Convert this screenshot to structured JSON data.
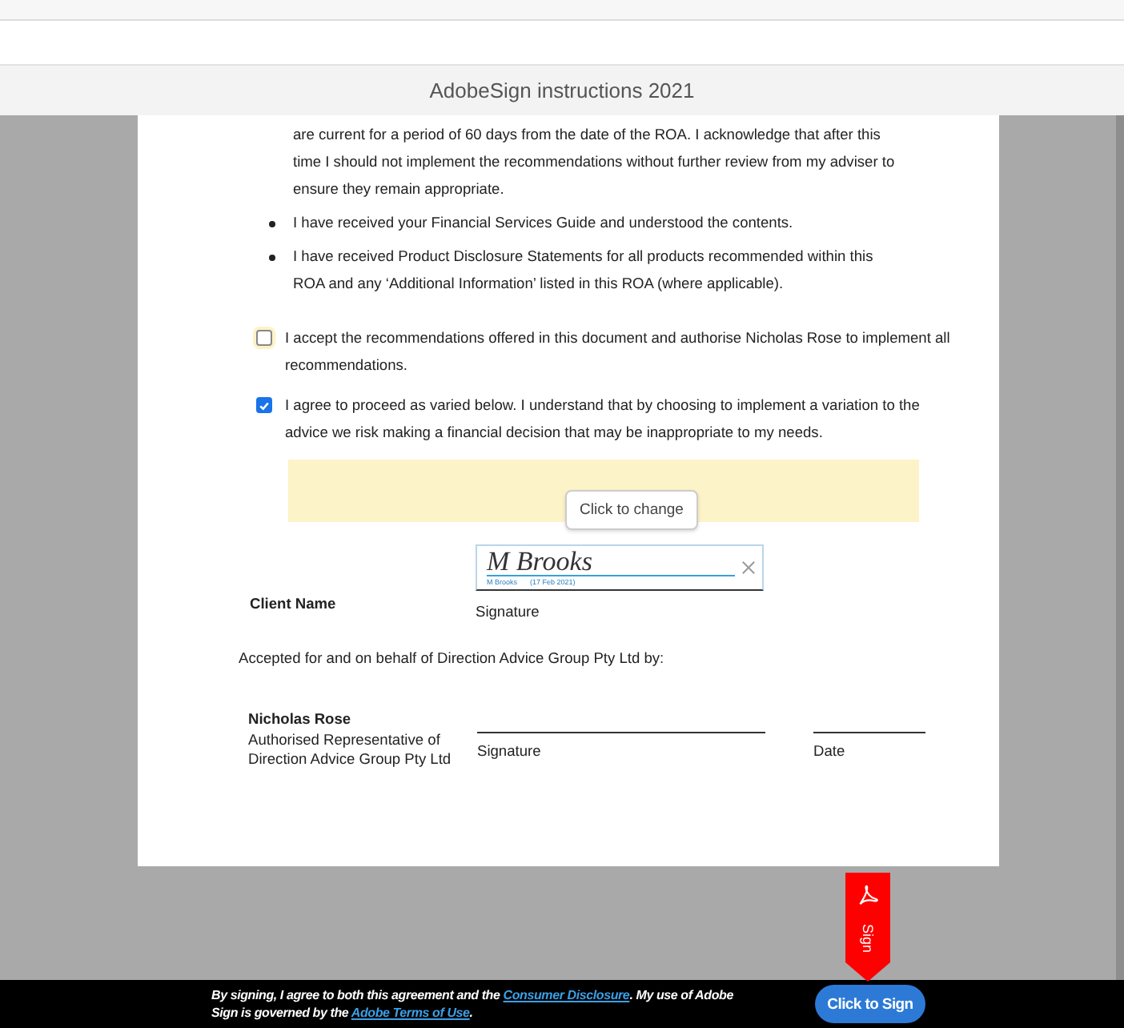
{
  "document_title": "AdobeSign instructions 2021",
  "document": {
    "continued_text": "are current for a period of 60 days from the date of the ROA. I acknowledge that after this time I should not implement the recommendations without further review from my adviser to ensure they remain appropriate.",
    "bullets": [
      "I have received your Financial Services Guide and understood the contents.",
      "I have received Product Disclosure Statements for all products recommended within this ROA and any ‘Additional Information’ listed in this ROA (where applicable)."
    ],
    "checkboxes": [
      {
        "label": "I accept the recommendations offered in this document and authorise Nicholas Rose to implement all recommendations.",
        "checked": false
      },
      {
        "label": "I agree to proceed as varied below. I understand that by choosing to implement a variation to the advice we risk making a financial decision that may be inappropriate to my needs.",
        "checked": true
      }
    ],
    "tooltip": "Click to change",
    "client_label": "Client Name",
    "signature_field": {
      "signature": "M Brooks",
      "signer": "M Brooks",
      "date": "(17 Feb 2021)"
    },
    "signature_caption": "Signature",
    "accepted_text": "Accepted for and on behalf of Direction Advice Group Pty Ltd by:",
    "representative": {
      "name": "Nicholas Rose",
      "title": "Authorised Representative of Direction Advice Group Pty Ltd",
      "signature_caption": "Signature",
      "date_caption": "Date"
    }
  },
  "sign_flag": "Sign",
  "footer": {
    "notice": [
      {
        "kind": "text",
        "text": "By signing, I agree to both this agreement and the "
      },
      {
        "kind": "link",
        "text": "Consumer Disclosure"
      },
      {
        "kind": "text",
        "text": ". My use of Adobe Sign is governed by the "
      },
      {
        "kind": "link",
        "text": "Adobe Terms of Use"
      },
      {
        "kind": "text",
        "text": "."
      }
    ],
    "button": "Click to Sign"
  }
}
